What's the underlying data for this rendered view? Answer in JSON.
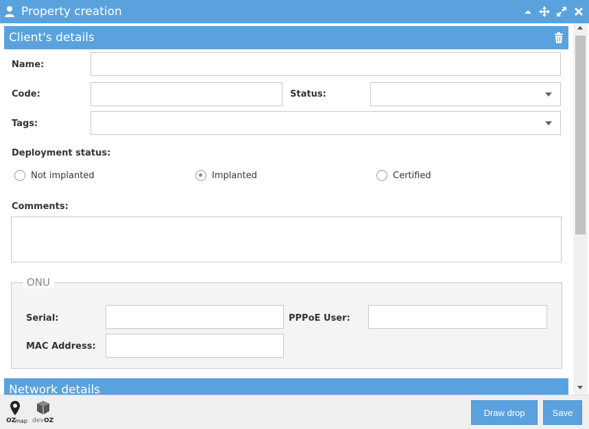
{
  "window": {
    "title": "Property creation"
  },
  "client_details": {
    "header": "Client's details",
    "name_label": "Name:",
    "code_label": "Code:",
    "status_label": "Status:",
    "tags_label": "Tags:",
    "deployment_label": "Deployment status:",
    "deployment_options": [
      {
        "label": "Not implanted",
        "checked": false
      },
      {
        "label": "Implanted",
        "checked": true
      },
      {
        "label": "Certified",
        "checked": false
      }
    ],
    "comments_label": "Comments:",
    "name_value": "",
    "code_value": "",
    "status_value": "",
    "tags_value": "",
    "comments_value": ""
  },
  "onu": {
    "legend": "ONU",
    "serial_label": "Serial:",
    "pppoe_label": "PPPoE User:",
    "mac_label": "MAC Address:",
    "serial_value": "",
    "pppoe_value": "",
    "mac_value": ""
  },
  "network_details": {
    "header": "Network details"
  },
  "footer": {
    "logo1_top": "OZ",
    "logo1_bottom": "map",
    "logo2_left": "dev",
    "logo2_right": "OZ",
    "draw_drop_label": "Draw drop",
    "save_label": "Save"
  },
  "colors": {
    "accent": "#5aa2de",
    "border": "#c8c8c8"
  },
  "icons": [
    "user-icon",
    "chevron-up-icon",
    "move-icon",
    "expand-icon",
    "close-icon",
    "trash-icon",
    "map-pin-icon",
    "box-icon"
  ]
}
